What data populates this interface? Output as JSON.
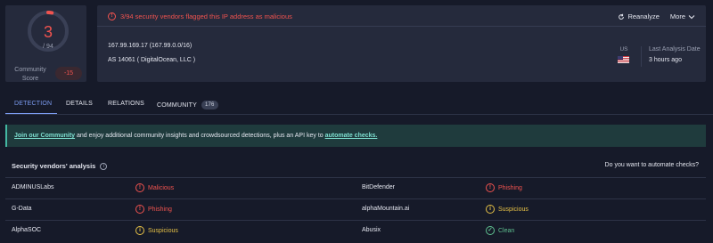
{
  "score": {
    "detections": "3",
    "total": "/ 94",
    "community_label": "Community Score",
    "community_score": "-15",
    "ring_color": "#f0534f",
    "ring_fraction": 0.032
  },
  "header": {
    "alert": "3/94 security vendors flagged this IP address as malicious",
    "reanalyze": "Reanalyze",
    "more": "More",
    "ip": "167.99.169.17  (167.99.0.0/16)",
    "as": "AS 14061  ( DigitalOcean, LLC )",
    "country": "US",
    "last_label": "Last Analysis Date",
    "last_value": "3 hours ago"
  },
  "tabs": [
    {
      "label": "DETECTION"
    },
    {
      "label": "DETAILS"
    },
    {
      "label": "RELATIONS"
    },
    {
      "label": "COMMUNITY",
      "count": "176"
    }
  ],
  "banner": {
    "link1": "Join our Community",
    "text": " and enjoy additional community insights and crowdsourced detections, plus an API key to ",
    "link2": "automate checks."
  },
  "vendors": {
    "title": "Security vendors' analysis",
    "question": "Do you want to automate checks?",
    "rows": [
      {
        "left_name": "ADMINUSLabs",
        "left_verdict": "Malicious",
        "left_type": "malicious",
        "right_name": "BitDefender",
        "right_verdict": "Phishing",
        "right_type": "malicious"
      },
      {
        "left_name": "G-Data",
        "left_verdict": "Phishing",
        "left_type": "malicious",
        "right_name": "alphaMountain.ai",
        "right_verdict": "Suspicious",
        "right_type": "suspicious"
      },
      {
        "left_name": "AlphaSOC",
        "left_verdict": "Suspicious",
        "left_type": "suspicious",
        "right_name": "Abusix",
        "right_verdict": "Clean",
        "right_type": "clean"
      }
    ]
  },
  "colors": {
    "accent": "#7c9cf2",
    "malicious": "#f0534f",
    "suspicious": "#e5c046",
    "clean": "#5fbf8f",
    "banner_link": "#7ee0d1"
  }
}
